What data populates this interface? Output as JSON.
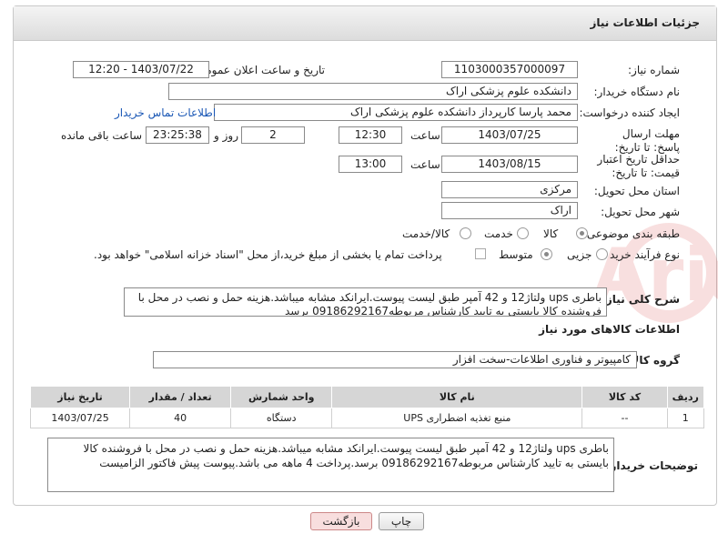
{
  "header": {
    "title": "جزئیات اطلاعات نیاز"
  },
  "form": {
    "need_number_label": "شماره نیاز:",
    "need_number": "1103000357000097",
    "announce_label": "تاریخ و ساعت اعلان عمومی:",
    "announce_value": "1403/07/22 - 12:20",
    "buyer_label": "نام دستگاه خریدار:",
    "buyer_value": "دانشکده علوم پزشکی اراک",
    "creator_label": "ایجاد کننده درخواست:",
    "creator_value": "محمد پارسا کارپرداز دانشکده علوم پزشکی اراک",
    "contact_link": "اطلاعات تماس خریدار",
    "deadline_label": "مهلت ارسال پاسخ: تا تاریخ:",
    "deadline_date": "1403/07/25",
    "time_label": "ساعت",
    "deadline_time": "12:30",
    "days_value": "2",
    "days_label": "روز و",
    "remaining_value": "23:25:38",
    "remaining_label": "ساعت باقی مانده",
    "validity_label": "حداقل تاریخ اعتبار قیمت: تا تاریخ:",
    "validity_date": "1403/08/15",
    "validity_time": "13:00",
    "province_label": "استان محل تحویل:",
    "province_value": "مرکزی",
    "city_label": "شهر محل تحویل:",
    "city_value": "اراک",
    "category_label": "طبقه بندی موضوعی:",
    "category_options": [
      "کالا",
      "خدمت",
      "کالا/خدمت"
    ],
    "process_label": "نوع فرآیند خرید :",
    "process_options": [
      "جزیی",
      "متوسط"
    ],
    "payment_note": "پرداخت تمام یا بخشی از مبلغ خرید،از محل \"اسناد خزانه اسلامی\" خواهد بود.",
    "description_label": "شرح کلی نیاز:",
    "description_value": "باطری ups ولتاژ12 و 42 آمپر طبق لیست پیوست.ایرانکد مشابه میباشد.هزینه حمل و نصب در محل با فروشنده کالا بایستی به تایید کارشناس مربوطه09186292167 برسد"
  },
  "goods": {
    "section_title": "اطلاعات کالاهای مورد نیاز",
    "group_label": "گروه کالا:",
    "group_value": "کامپیوتر و فناوری اطلاعات-سخت افزار",
    "columns": [
      "ردیف",
      "کد کالا",
      "نام کالا",
      "واحد شمارش",
      "تعداد / مقدار",
      "تاریخ نیاز"
    ],
    "rows": [
      {
        "row": "1",
        "code": "--",
        "name": "منبع تغذیه اضطراری UPS",
        "unit": "دستگاه",
        "qty": "40",
        "date": "1403/07/25"
      }
    ]
  },
  "buyer_notes": {
    "label": "توضیحات خریدار:",
    "value": "باطری ups ولتاژ12 و 42 آمپر طبق لیست پیوست.ایرانکد مشابه میباشد.هزینه حمل و نصب در محل با فروشنده کالا بایستی به تایید کارشناس مربوطه09186292167 برسد.پرداخت 4 ماهه می باشد.پیوست پیش فاکتور الزامیست"
  },
  "buttons": {
    "print": "چاپ",
    "back": "بازگشت"
  },
  "watermark_text": "AriaTender.net"
}
